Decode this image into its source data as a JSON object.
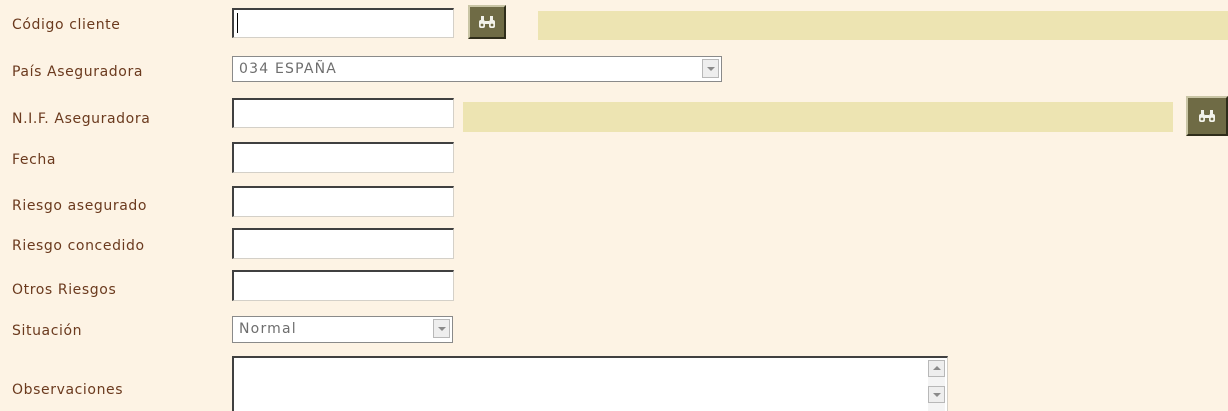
{
  "form": {
    "codigo_cliente": {
      "label": "Código cliente",
      "value": ""
    },
    "pais_aseguradora": {
      "label": "País Aseguradora",
      "selected": "034 ESPAÑA"
    },
    "nif_aseguradora": {
      "label": "N.I.F. Aseguradora",
      "value": ""
    },
    "fecha": {
      "label": "Fecha",
      "value": ""
    },
    "riesgo_asegurado": {
      "label": "Riesgo asegurado",
      "value": ""
    },
    "riesgo_concedido": {
      "label": "Riesgo concedido",
      "value": ""
    },
    "otros_riesgos": {
      "label": "Otros Riesgos",
      "value": ""
    },
    "situacion": {
      "label": "Situación",
      "selected": "Normal"
    },
    "observaciones": {
      "label": "Observaciones",
      "value": ""
    }
  },
  "icons": {
    "search": "binoculars-icon",
    "dropdown": "chevron-down-icon",
    "scroll_up": "arrow-up-icon",
    "scroll_down": "arrow-down-icon"
  },
  "colors": {
    "background": "#fdf3e4",
    "label_text": "#6b3a1e",
    "info_bar": "#ede4b2",
    "search_button": "#6f6b45"
  }
}
